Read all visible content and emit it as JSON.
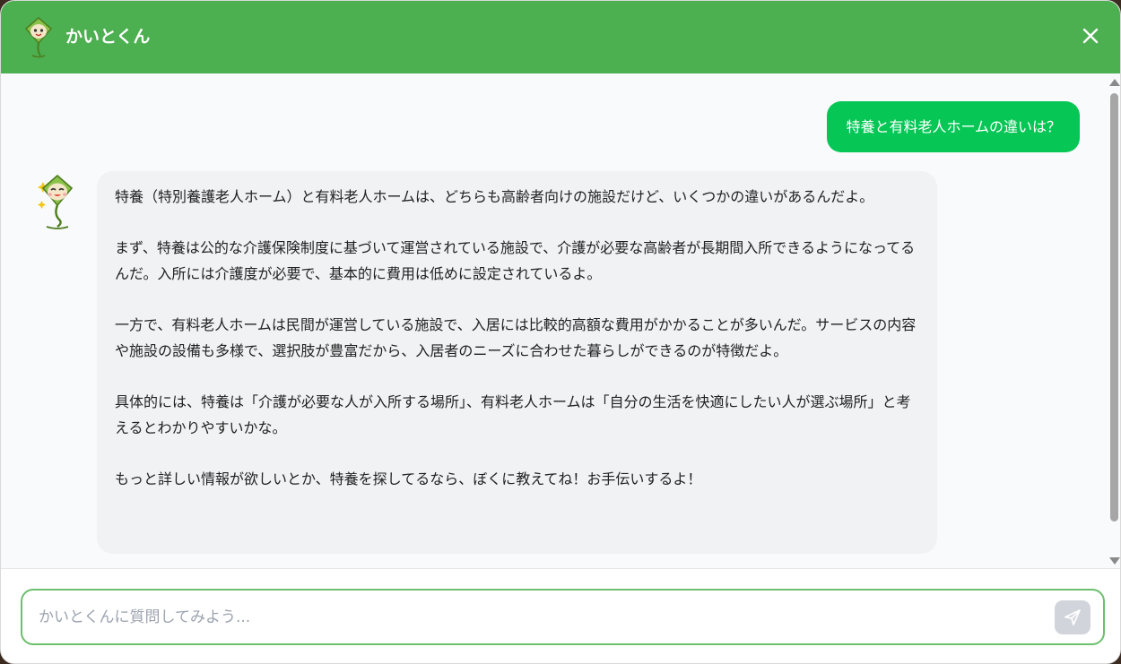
{
  "header": {
    "title": "かいとくん",
    "avatar_icon": "mascot-icon",
    "close_icon": "close-icon",
    "background": "#4caf50"
  },
  "chat": {
    "user_message": "特養と有料老人ホームの違いは？",
    "bot_paragraphs": [
      "特養（特別養護老人ホーム）と有料老人ホームは、どちらも高齢者向けの施設だけど、いくつかの違いがあるんだよ。",
      "まず、特養は公的な介護保険制度に基づいて運営されている施設で、介護が必要な高齢者が長期間入所できるようになってるんだ。入所には介護度が必要で、基本的に費用は低めに設定されているよ。",
      "一方で、有料老人ホームは民間が運営している施設で、入居には比較的高額な費用がかかることが多いんだ。サービスの内容や施設の設備も多様で、選択肢が豊富だから、入居者のニーズに合わせた暮らしができるのが特徴だよ。",
      "具体的には、特養は「介護が必要な人が入所する場所」、有料老人ホームは「自分の生活を快適にしたい人が選ぶ場所」と考えるとわかりやすいかな。",
      "もっと詳しい情報が欲しいとか、特養を探してるなら、ぼくに教えてね！お手伝いするよ！"
    ],
    "user_bubble_color": "#06c755"
  },
  "input": {
    "placeholder": "かいとくんに質問してみよう...",
    "value": "",
    "send_icon": "send-icon"
  }
}
